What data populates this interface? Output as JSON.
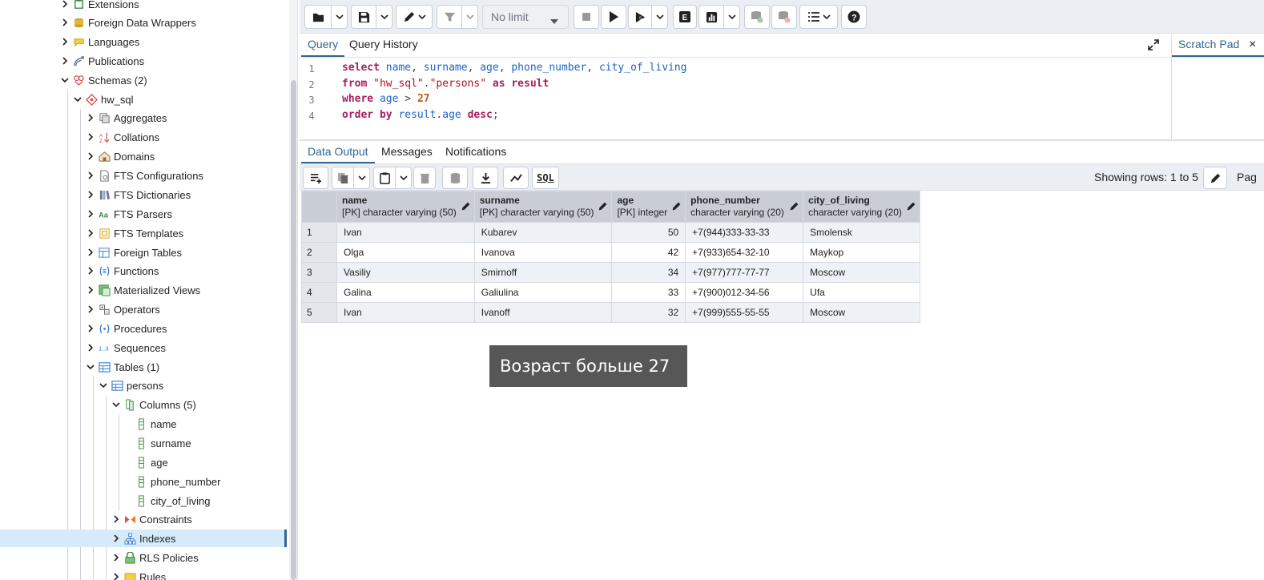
{
  "sidebar": {
    "items": [
      {
        "label": "Extensions",
        "icon": "extensions-icon",
        "state": "collapsed"
      },
      {
        "label": "Foreign Data Wrappers",
        "icon": "foreign-data-wrappers-icon",
        "state": "collapsed"
      },
      {
        "label": "Languages",
        "icon": "languages-icon",
        "state": "collapsed"
      },
      {
        "label": "Publications",
        "icon": "publications-icon",
        "state": "collapsed"
      },
      {
        "label": "Schemas (2)",
        "icon": "schemas-icon",
        "state": "expanded"
      },
      {
        "label": "hw_sql",
        "icon": "schema-icon",
        "state": "expanded"
      },
      {
        "label": "Aggregates",
        "icon": "aggregates-icon",
        "state": "collapsed"
      },
      {
        "label": "Collations",
        "icon": "collations-icon",
        "state": "collapsed"
      },
      {
        "label": "Domains",
        "icon": "domains-icon",
        "state": "collapsed"
      },
      {
        "label": "FTS Configurations",
        "icon": "fts-configurations-icon",
        "state": "collapsed"
      },
      {
        "label": "FTS Dictionaries",
        "icon": "fts-dictionaries-icon",
        "state": "collapsed"
      },
      {
        "label": "FTS Parsers",
        "icon": "fts-parsers-icon",
        "state": "collapsed"
      },
      {
        "label": "FTS Templates",
        "icon": "fts-templates-icon",
        "state": "collapsed"
      },
      {
        "label": "Foreign Tables",
        "icon": "foreign-tables-icon",
        "state": "collapsed"
      },
      {
        "label": "Functions",
        "icon": "functions-icon",
        "state": "collapsed"
      },
      {
        "label": "Materialized Views",
        "icon": "materialized-views-icon",
        "state": "collapsed"
      },
      {
        "label": "Operators",
        "icon": "operators-icon",
        "state": "collapsed"
      },
      {
        "label": "Procedures",
        "icon": "procedures-icon",
        "state": "collapsed"
      },
      {
        "label": "Sequences",
        "icon": "sequences-icon",
        "state": "collapsed"
      },
      {
        "label": "Tables (1)",
        "icon": "tables-icon",
        "state": "expanded"
      },
      {
        "label": "persons",
        "icon": "table-icon",
        "state": "expanded"
      },
      {
        "label": "Columns (5)",
        "icon": "columns-icon",
        "state": "expanded"
      },
      {
        "label": "name",
        "icon": "column-icon",
        "state": "leaf"
      },
      {
        "label": "surname",
        "icon": "column-icon",
        "state": "leaf"
      },
      {
        "label": "age",
        "icon": "column-icon",
        "state": "leaf"
      },
      {
        "label": "phone_number",
        "icon": "column-icon",
        "state": "leaf"
      },
      {
        "label": "city_of_living",
        "icon": "column-icon",
        "state": "leaf"
      },
      {
        "label": "Constraints",
        "icon": "constraints-icon",
        "state": "collapsed"
      },
      {
        "label": "Indexes",
        "icon": "indexes-icon",
        "state": "collapsed",
        "selected": true
      },
      {
        "label": "RLS Policies",
        "icon": "rls-policies-icon",
        "state": "collapsed"
      },
      {
        "label": "Rules",
        "icon": "rules-icon",
        "state": "collapsed"
      }
    ]
  },
  "toolbar": {
    "limit_select": "No limit",
    "buttons": [
      "open-file-icon",
      "save-icon",
      "edit-icon",
      "filter-icon",
      "stop-icon",
      "execute-icon",
      "explain-icon",
      "explain-analyze-icon",
      "chart-icon",
      "commit-icon",
      "rollback-icon",
      "macros-icon",
      "help-icon"
    ]
  },
  "query_tabs": {
    "query": "Query",
    "history": "Query History"
  },
  "scratch_pad": {
    "title": "Scratch Pad",
    "close": "×"
  },
  "editor": {
    "line_numbers": [
      "1",
      "2",
      "3",
      "4"
    ]
  },
  "result_tabs": {
    "data_output": "Data Output",
    "messages": "Messages",
    "notifications": "Notifications"
  },
  "result_toolbar": {
    "showing_rows": "Showing rows: 1 to 5",
    "page_label": "Pag",
    "sql_button": "SQL"
  },
  "grid": {
    "columns": [
      {
        "name": "name",
        "type": "[PK] character varying (50)"
      },
      {
        "name": "surname",
        "type": "[PK] character varying (50)"
      },
      {
        "name": "age",
        "type": "[PK] integer"
      },
      {
        "name": "phone_number",
        "type": "character varying (20)"
      },
      {
        "name": "city_of_living",
        "type": "character varying (20)"
      }
    ],
    "rows": [
      {
        "num": "1",
        "name": "Ivan",
        "surname": "Kubarev",
        "age": "50",
        "phone": "+7(944)333-33-33",
        "city": "Smolensk"
      },
      {
        "num": "2",
        "name": "Olga",
        "surname": "Ivanova",
        "age": "42",
        "phone": "+7(933)654-32-10",
        "city": "Maykop"
      },
      {
        "num": "3",
        "name": "Vasiliy",
        "surname": "Smirnoff",
        "age": "34",
        "phone": "+7(977)777-77-77",
        "city": "Moscow"
      },
      {
        "num": "4",
        "name": "Galina",
        "surname": "Galiulina",
        "age": "33",
        "phone": "+7(900)012-34-56",
        "city": "Ufa"
      },
      {
        "num": "5",
        "name": "Ivan",
        "surname": "Ivanoff",
        "age": "32",
        "phone": "+7(999)555-55-55",
        "city": "Moscow"
      }
    ]
  },
  "caption": "Возраст больше 27",
  "colors": {
    "accent": "#326690",
    "selected_row": "#d6ebfa",
    "keyword": "#a71d5d",
    "identifier": "#1f63c2",
    "string": "#b5101e",
    "number": "#b65d1f",
    "caption_bg": "#575757"
  }
}
